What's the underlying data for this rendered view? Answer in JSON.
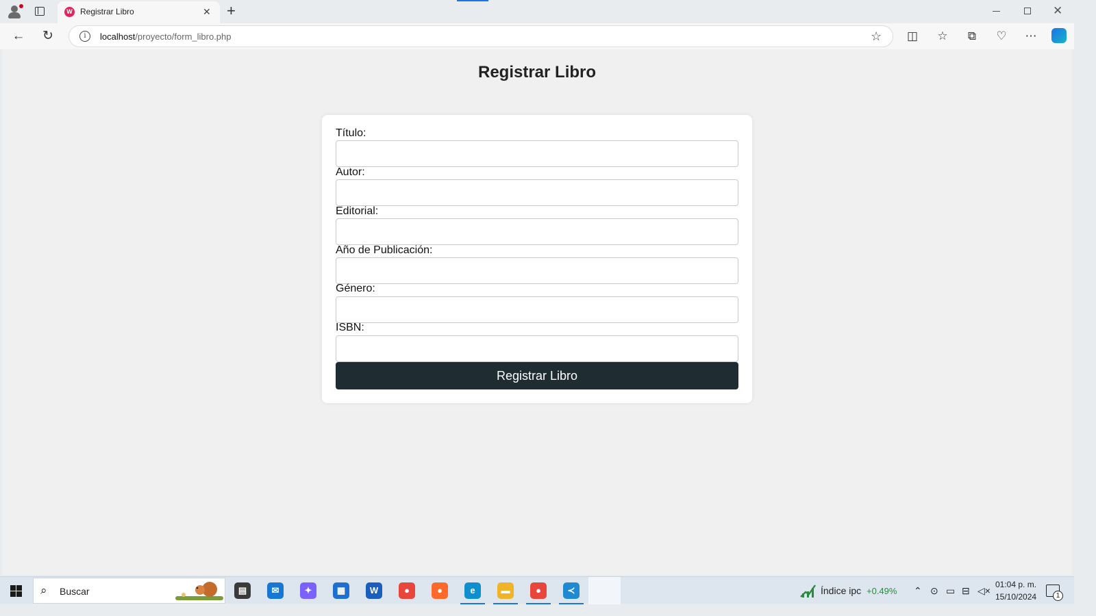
{
  "browser": {
    "tab_title": "Registrar Libro",
    "tab_close": "✕",
    "new_tab": "+",
    "favicon_letter": "W",
    "url_host": "localhost",
    "url_path": "/proyecto/form_libro.php",
    "icons": [
      "profile-icon",
      "tab-actions-icon",
      "back-icon",
      "refresh-icon",
      "site-info-icon",
      "favorite-star-icon",
      "split-screen-icon",
      "favorites-icon",
      "collections-icon",
      "browser-essentials-icon",
      "more-icon",
      "copilot-icon"
    ]
  },
  "page": {
    "title": "Registrar Libro",
    "form": {
      "fields": [
        {
          "label": "Título:",
          "value": ""
        },
        {
          "label": "Autor:",
          "value": ""
        },
        {
          "label": "Editorial:",
          "value": ""
        },
        {
          "label": "Año de Publicación:",
          "value": ""
        },
        {
          "label": "Género:",
          "value": ""
        },
        {
          "label": "ISBN:",
          "value": ""
        }
      ],
      "submit_label": "Registrar Libro"
    }
  },
  "taskbar": {
    "search_label": "Buscar",
    "apps": [
      {
        "name": "task-view-icon",
        "color": "#3a3a3a",
        "glyph": "▤"
      },
      {
        "name": "mail-icon",
        "color": "#1877d2",
        "glyph": "✉"
      },
      {
        "name": "copilot-app-icon",
        "color": "#7b61ff",
        "glyph": "✦"
      },
      {
        "name": "store-icon",
        "color": "#1f6fd1",
        "glyph": "▦"
      },
      {
        "name": "word-icon",
        "color": "#1b5ebe",
        "glyph": "W"
      },
      {
        "name": "chrome-icon",
        "color": "#e8453c",
        "glyph": "●"
      },
      {
        "name": "firefox-icon",
        "color": "#ff6a2b",
        "glyph": "●"
      },
      {
        "name": "edge-icon",
        "color": "#0f8fcf",
        "glyph": "e"
      },
      {
        "name": "file-explorer-icon",
        "color": "#f0b429",
        "glyph": "▬"
      },
      {
        "name": "chrome-icon-2",
        "color": "#e8453c",
        "glyph": "●"
      },
      {
        "name": "vscode-icon",
        "color": "#1f8ad2",
        "glyph": "≺"
      },
      {
        "name": "xampp-icon",
        "color": "#f46b2c",
        "glyph": "✕"
      }
    ],
    "ipc_label": "Índice ipc",
    "ipc_value": "+0.49%",
    "clock_time": "01:04 p. m.",
    "clock_date": "15/10/2024",
    "notification_count": "1"
  }
}
